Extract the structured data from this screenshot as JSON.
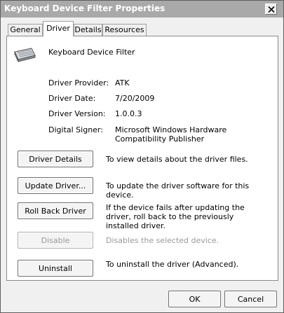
{
  "window": {
    "title": "Keyboard Device Filter Properties",
    "close_icon": "close-icon"
  },
  "tabs": [
    {
      "label": "General",
      "active": false
    },
    {
      "label": "Driver",
      "active": true
    },
    {
      "label": "Details",
      "active": false
    },
    {
      "label": "Resources",
      "active": false
    }
  ],
  "device": {
    "icon": "keyboard-icon",
    "name": "Keyboard Device Filter"
  },
  "properties": [
    {
      "label": "Driver Provider:",
      "value": "ATK"
    },
    {
      "label": "Driver Date:",
      "value": "7/20/2009"
    },
    {
      "label": "Driver Version:",
      "value": "1.0.0.3"
    },
    {
      "label": "Digital Signer:",
      "value": "Microsoft Windows Hardware Compatibility Publisher"
    }
  ],
  "actions": [
    {
      "label": "Driver Details",
      "description": "To view details about the driver files.",
      "enabled": true
    },
    {
      "label": "Update Driver...",
      "description": "To update the driver software for this device.",
      "enabled": true
    },
    {
      "label": "Roll Back Driver",
      "description": "If the device fails after updating the driver, roll back to the previously installed driver.",
      "enabled": true
    },
    {
      "label": "Disable",
      "description": "Disables the selected device.",
      "enabled": false
    },
    {
      "label": "Uninstall",
      "description": "To uninstall the driver (Advanced).",
      "enabled": true
    }
  ],
  "footer": {
    "ok_label": "OK",
    "cancel_label": "Cancel"
  },
  "colors": {
    "titlebar": "#a9a9a9",
    "disabled_text": "#9a9a9a"
  }
}
